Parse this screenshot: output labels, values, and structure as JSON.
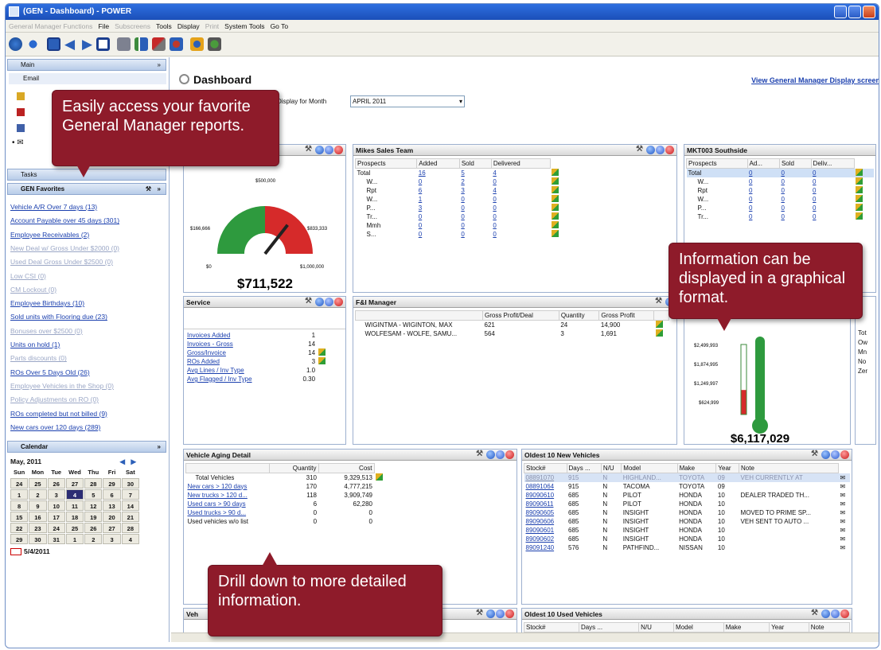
{
  "window": {
    "title": "(GEN - Dashboard) - POWER"
  },
  "menu": [
    {
      "label": "General Manager Functions",
      "dim": true
    },
    {
      "label": "File",
      "dim": false
    },
    {
      "label": "Subscreens",
      "dim": true
    },
    {
      "label": "Tools",
      "dim": false
    },
    {
      "label": "Display",
      "dim": false
    },
    {
      "label": "Print",
      "dim": true
    },
    {
      "label": "System Tools",
      "dim": false
    },
    {
      "label": "Go To",
      "dim": false
    }
  ],
  "sidebar": {
    "main_label": "Main",
    "email_label": "Email",
    "tasks_label": "Tasks",
    "favorites_label": "GEN Favorites",
    "favorites": [
      {
        "label": "Vehicle A/R Over 7 days (13)",
        "dim": false
      },
      {
        "label": "Account Payable over 45 days (301)",
        "dim": false
      },
      {
        "label": "Employee Receivables (2)",
        "dim": false
      },
      {
        "label": "New Deal w/ Gross Under $2000 (0)",
        "dim": true
      },
      {
        "label": "Used Deal Gross Under $2500 (0)",
        "dim": true
      },
      {
        "label": "Low CSI (0)",
        "dim": true
      },
      {
        "label": "CM Lockout (0)",
        "dim": true
      },
      {
        "label": "Employee Birthdays (10)",
        "dim": false
      },
      {
        "label": "Sold units with Flooring due (23)",
        "dim": false
      },
      {
        "label": "Bonuses over $2500 (0)",
        "dim": true
      },
      {
        "label": "Units on hold (1)",
        "dim": false
      },
      {
        "label": "Parts discounts (0)",
        "dim": true
      },
      {
        "label": "ROs Over 5 Days Old (26)",
        "dim": false
      },
      {
        "label": "Employee Vehicles in the Shop (0)",
        "dim": true
      },
      {
        "label": "Policy Adjustments on RO (0)",
        "dim": true
      },
      {
        "label": "ROs completed but not billed (9)",
        "dim": false
      },
      {
        "label": "New cars over 120 days (289)",
        "dim": false
      }
    ],
    "calendar_label": "Calendar",
    "calendar": {
      "month": "May, 2011",
      "days": [
        "Sun",
        "Mon",
        "Tue",
        "Wed",
        "Thu",
        "Fri",
        "Sat"
      ],
      "weeks": [
        [
          "24",
          "25",
          "26",
          "27",
          "28",
          "29",
          "30"
        ],
        [
          "1",
          "2",
          "3",
          "4",
          "5",
          "6",
          "7"
        ],
        [
          "8",
          "9",
          "10",
          "11",
          "12",
          "13",
          "14"
        ],
        [
          "15",
          "16",
          "17",
          "18",
          "19",
          "20",
          "21"
        ],
        [
          "22",
          "23",
          "24",
          "25",
          "26",
          "27",
          "28"
        ],
        [
          "29",
          "30",
          "31",
          "1",
          "2",
          "3",
          "4"
        ]
      ],
      "selected": "4",
      "today": "5/4/2011"
    }
  },
  "main": {
    "title": "Dashboard",
    "view_link": "View General Manager Display screen",
    "display_month_label": "Display for Month",
    "display_month_value": "APRIL 2011"
  },
  "gauge": {
    "labels": [
      "$500,000",
      "$166,666",
      "$833,333",
      "$0",
      "$1,000,000"
    ],
    "value": "$711,522",
    "level": 0.7115
  },
  "sales_team": {
    "title": "Mikes Sales Team",
    "columns": [
      "Prospects",
      "Added",
      "Sold",
      "Delivered"
    ],
    "rows": [
      [
        "Total",
        "16",
        "5",
        "4"
      ],
      [
        "W...",
        "0",
        "2",
        "0"
      ],
      [
        "Rpt",
        "6",
        "3",
        "4"
      ],
      [
        "W...",
        "1",
        "0",
        "0"
      ],
      [
        "P...",
        "3",
        "0",
        "0"
      ],
      [
        "Tr...",
        "0",
        "0",
        "0"
      ],
      [
        "Mmh",
        "0",
        "0",
        "0"
      ],
      [
        "S...",
        "0",
        "0",
        "0"
      ]
    ]
  },
  "southside": {
    "title": "MKT003 Southside",
    "columns": [
      "Prospects",
      "Ad...",
      "Sold",
      "Deliv..."
    ],
    "rows": [
      [
        "Total",
        "0",
        "0",
        "0"
      ],
      [
        "W...",
        "0",
        "0",
        "0"
      ],
      [
        "Rpt",
        "0",
        "0",
        "0"
      ],
      [
        "W...",
        "0",
        "0",
        "0"
      ],
      [
        "P...",
        "0",
        "0",
        "0"
      ],
      [
        "Tr...",
        "0",
        "0",
        "0"
      ]
    ]
  },
  "service": {
    "title": "Service",
    "rows": [
      [
        "Invoices Added",
        "1",
        false
      ],
      [
        "Invoices - Gross",
        "14",
        false
      ],
      [
        "Gross/Invoice",
        "14",
        true
      ],
      [
        "ROs Added",
        "3",
        true
      ],
      [
        "Avg Lines / Inv Type",
        "1.0",
        false
      ],
      [
        "Avg Flagged / Inv Type",
        "0.30",
        false
      ]
    ]
  },
  "fi": {
    "title": "F&I Manager",
    "columns": [
      "Gross Profit/Deal",
      "Quantity",
      "Gross Profit"
    ],
    "rows": [
      [
        "WIGINTMA - WIGINTON, MAX",
        "621",
        "24",
        "14,900"
      ],
      [
        "WOLFESAM - WOLFE, SAMU...",
        "564",
        "3",
        "1,691"
      ]
    ]
  },
  "thermo": {
    "labels": [
      "$2,499,993",
      "$1,874,995",
      "$1,249,997",
      "$624,999"
    ],
    "value": "$6,117,029",
    "level": 0.35
  },
  "right_partial": {
    "rows": [
      "Tot",
      "Ow",
      "Mn",
      "No",
      "Zer"
    ]
  },
  "aging": {
    "title": "Vehicle Aging Detail",
    "columns": [
      "Quantity",
      "Cost"
    ],
    "rows": [
      [
        "Total Vehicles",
        "310",
        "9,329,513",
        false
      ],
      [
        "New cars > 120 days",
        "170",
        "4,777,215",
        true
      ],
      [
        "New trucks > 120 d...",
        "118",
        "3,909,749",
        true
      ],
      [
        "Used cars > 90 days",
        "6",
        "62,280",
        true
      ],
      [
        "Used trucks > 90 d...",
        "0",
        "0",
        true
      ],
      [
        "Used vehicles w/o list",
        "0",
        "0",
        false
      ]
    ]
  },
  "oldest_new": {
    "title": "Oldest 10 New Vehicles",
    "columns": [
      "Stock#",
      "Days ...",
      "N/U",
      "Model",
      "Make",
      "Year",
      "Note"
    ],
    "rows": [
      [
        "08891070",
        "915",
        "N",
        "HIGHLAND...",
        "TOYOTA",
        "09",
        "VEH CURRENTLY AT"
      ],
      [
        "08891064",
        "915",
        "N",
        "TACOMA",
        "TOYOTA",
        "09",
        ""
      ],
      [
        "89090610",
        "685",
        "N",
        "PILOT",
        "HONDA",
        "10",
        "DEALER TRADED TH..."
      ],
      [
        "89090611",
        "685",
        "N",
        "PILOT",
        "HONDA",
        "10",
        ""
      ],
      [
        "89090605",
        "685",
        "N",
        "INSIGHT",
        "HONDA",
        "10",
        "MOVED TO PRIME SP..."
      ],
      [
        "89090606",
        "685",
        "N",
        "INSIGHT",
        "HONDA",
        "10",
        "VEH SENT TO AUTO ..."
      ],
      [
        "89090601",
        "685",
        "N",
        "INSIGHT",
        "HONDA",
        "10",
        ""
      ],
      [
        "89090602",
        "685",
        "N",
        "INSIGHT",
        "HONDA",
        "10",
        ""
      ],
      [
        "89091240",
        "576",
        "N",
        "PATHFIND...",
        "NISSAN",
        "10",
        ""
      ]
    ]
  },
  "bottom_left": {
    "title": "Veh"
  },
  "oldest_used": {
    "title": "Oldest 10 Used Vehicles",
    "columns": [
      "Stock#",
      "Days ...",
      "N/U",
      "Model",
      "Make",
      "Year",
      "Note"
    ]
  },
  "callouts": {
    "favorites": "Easily access your favorite General Manager reports.",
    "graphical": "Information can be displayed in a graphical format.",
    "drill": "Drill down to more detailed information."
  },
  "colors": {
    "accent": "#8e1b2a",
    "title_bar": "#2f6fe0",
    "link": "#1a3fae"
  }
}
